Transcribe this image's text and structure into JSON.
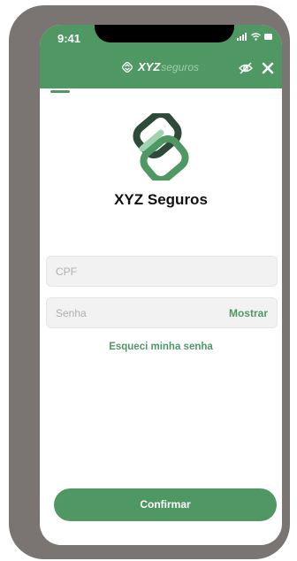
{
  "status_bar": {
    "time": "9:41"
  },
  "header": {
    "brand_bold": "XYZ",
    "brand_light": "seguros",
    "hide_icon": "eye-off-icon",
    "close_icon": "close-icon"
  },
  "colors": {
    "primary": "#4f9864",
    "phone_frame": "#7a7472",
    "field_bg": "#f2f2f2"
  },
  "app": {
    "title": "XYZ Seguros",
    "logo_icon": "xyz-logo-icon"
  },
  "form": {
    "cpf_placeholder": "CPF",
    "password_placeholder": "Senha",
    "show_label": "Mostrar",
    "forgot_label": "Esqueci minha senha",
    "confirm_label": "Confirmar"
  }
}
